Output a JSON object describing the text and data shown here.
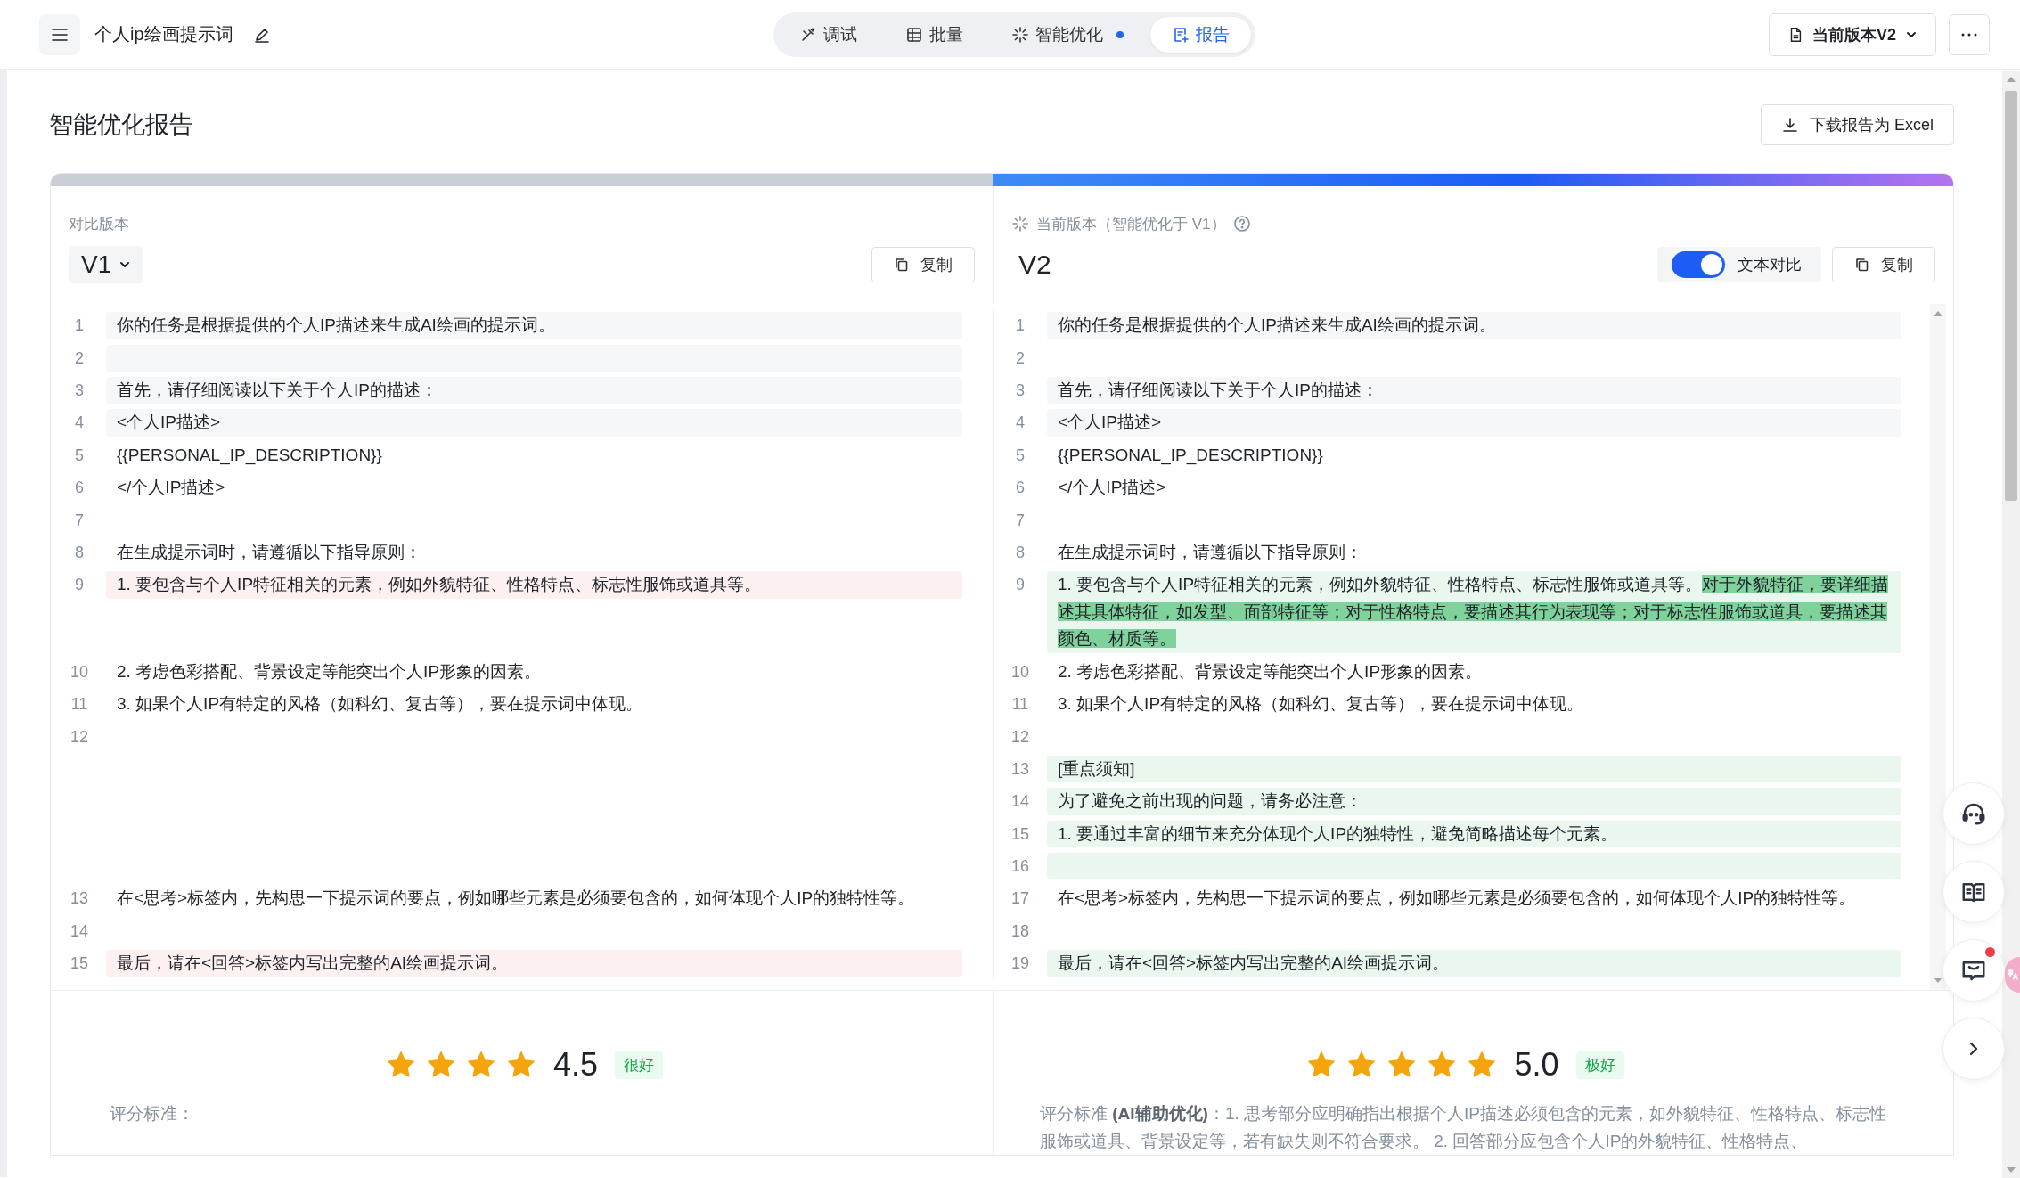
{
  "header": {
    "title": "个人ip绘画提示词",
    "tabs": [
      {
        "label": "调试",
        "kind": "debug",
        "selected": false,
        "dot": false
      },
      {
        "label": "批量",
        "kind": "batch",
        "selected": false,
        "dot": false
      },
      {
        "label": "智能优化",
        "kind": "optimize",
        "selected": false,
        "dot": true
      },
      {
        "label": "报告",
        "kind": "report",
        "selected": true,
        "dot": false
      }
    ],
    "version_button": "当前版本V2"
  },
  "report": {
    "title": "智能优化报告",
    "download_button": "下载报告为 Excel"
  },
  "left_panel": {
    "label": "对比版本",
    "version": "V1",
    "copy_button": "复制"
  },
  "right_panel": {
    "label": "当前版本（智能优化于 V1）",
    "version": "V2",
    "toggle": {
      "label": "文本对比",
      "on": true
    },
    "copy_button": "复制"
  },
  "diff_rows": [
    {
      "left": {
        "number": "1",
        "text": "你的任务是根据提供的个人IP描述来生成AI绘画的提示词。",
        "kind": "shaded"
      },
      "right": {
        "number": "1",
        "text": "你的任务是根据提供的个人IP描述来生成AI绘画的提示词。",
        "kind": "shaded"
      }
    },
    {
      "left": {
        "number": "2",
        "kind": "shaded"
      },
      "right": {
        "number": "2",
        "kind": "plain"
      }
    },
    {
      "left": {
        "number": "3",
        "text": "首先，请仔细阅读以下关于个人IP的描述：",
        "kind": "shaded"
      },
      "right": {
        "number": "3",
        "text": "首先，请仔细阅读以下关于个人IP的描述：",
        "kind": "shaded"
      }
    },
    {
      "left": {
        "number": "4",
        "text": "<个人IP描述>",
        "kind": "shaded"
      },
      "right": {
        "number": "4",
        "text": "<个人IP描述>",
        "kind": "shaded"
      }
    },
    {
      "left": {
        "number": "5",
        "text": "{{PERSONAL_IP_DESCRIPTION}}",
        "kind": "plain"
      },
      "right": {
        "number": "5",
        "text": "{{PERSONAL_IP_DESCRIPTION}}",
        "kind": "plain"
      }
    },
    {
      "left": {
        "number": "6",
        "text": "</个人IP描述>",
        "kind": "plain"
      },
      "right": {
        "number": "6",
        "text": "</个人IP描述>",
        "kind": "plain"
      }
    },
    {
      "left": {
        "number": "7",
        "kind": "plain"
      },
      "right": {
        "number": "7",
        "kind": "plain"
      }
    },
    {
      "left": {
        "number": "8",
        "text": "在生成提示词时，请遵循以下指导原则：",
        "kind": "plain"
      },
      "right": {
        "number": "8",
        "text": "在生成提示词时，请遵循以下指导原则：",
        "kind": "plain"
      }
    },
    {
      "left": {
        "number": "9",
        "text": "1. 要包含与个人IP特征相关的元素，例如外貌特征、性格特点、标志性服饰或道具等。",
        "kind": "removed"
      },
      "right": {
        "number": "9",
        "text": "1. 要包含与个人IP特征相关的元素，例如外貌特征、性格特点、标志性服饰或道具等。",
        "added_text": "对于外貌特征，要详细描述其具体特征，如发型、面部特征等；对于性格特点，要描述其行为表现等；对于标志性服饰或道具，要描述其颜色、材质等。",
        "kind": "added"
      }
    },
    {
      "left": {
        "number": "10",
        "text": "2. 考虑色彩搭配、背景设定等能突出个人IP形象的因素。",
        "kind": "plain"
      },
      "right": {
        "number": "10",
        "text": "2. 考虑色彩搭配、背景设定等能突出个人IP形象的因素。",
        "kind": "plain"
      }
    },
    {
      "left": {
        "number": "11",
        "text": "3. 如果个人IP有特定的风格（如科幻、复古等），要在提示词中体现。",
        "kind": "plain"
      },
      "right": {
        "number": "11",
        "text": "3. 如果个人IP有特定的风格（如科幻、复古等），要在提示词中体现。",
        "kind": "plain"
      }
    },
    {
      "left": {
        "number": "12",
        "kind": "plain"
      },
      "right": {
        "number": "12",
        "kind": "plain"
      }
    },
    {
      "right": {
        "number": "13",
        "text": "[重点须知]",
        "kind": "added"
      }
    },
    {
      "right": {
        "number": "14",
        "text": "为了避免之前出现的问题，请务必注意：",
        "kind": "added"
      }
    },
    {
      "right": {
        "number": "15",
        "text": "1. 要通过丰富的细节来充分体现个人IP的独特性，避免简略描述每个元素。",
        "kind": "added"
      }
    },
    {
      "right": {
        "number": "16",
        "kind": "added"
      }
    },
    {
      "left": {
        "number": "13",
        "text": "在<思考>标签内，先构思一下提示词的要点，例如哪些元素是必须要包含的，如何体现个人IP的独特性等。",
        "kind": "plain"
      },
      "right": {
        "number": "17",
        "text": "在<思考>标签内，先构思一下提示词的要点，例如哪些元素是必须要包含的，如何体现个人IP的独特性等。",
        "kind": "plain"
      }
    },
    {
      "left": {
        "number": "14",
        "kind": "plain"
      },
      "right": {
        "number": "18",
        "kind": "plain"
      }
    },
    {
      "left": {
        "number": "15",
        "text": "最后，请在<回答>标签内写出完整的AI绘画提示词。",
        "kind": "removed"
      },
      "right": {
        "number": "19",
        "text": "最后，请在<回答>标签内写出完整的AI绘画提示词。",
        "kind": "added"
      }
    }
  ],
  "ratings": [
    {
      "stars": 4,
      "score": "4.5",
      "badge": "很好",
      "criteria": "评分标准："
    },
    {
      "stars": 5,
      "score": "5.0",
      "badge": "极好",
      "criteria": "评分标准 **(AI辅助优化)**：1. 思考部分应明确指出根据个人IP描述必须包含的元素，如外貌特征、性格特点、标志性服饰或道具、背景设定等，若有缺失则不符合要求。 2. 回答部分应包含个人IP的外貌特征、性格特点、"
    }
  ],
  "floating_actions": [
    {
      "kind": "support",
      "unread": false
    },
    {
      "kind": "docs",
      "unread": false
    },
    {
      "kind": "feedback",
      "unread": true
    },
    {
      "kind": "expand",
      "unread": false
    }
  ]
}
